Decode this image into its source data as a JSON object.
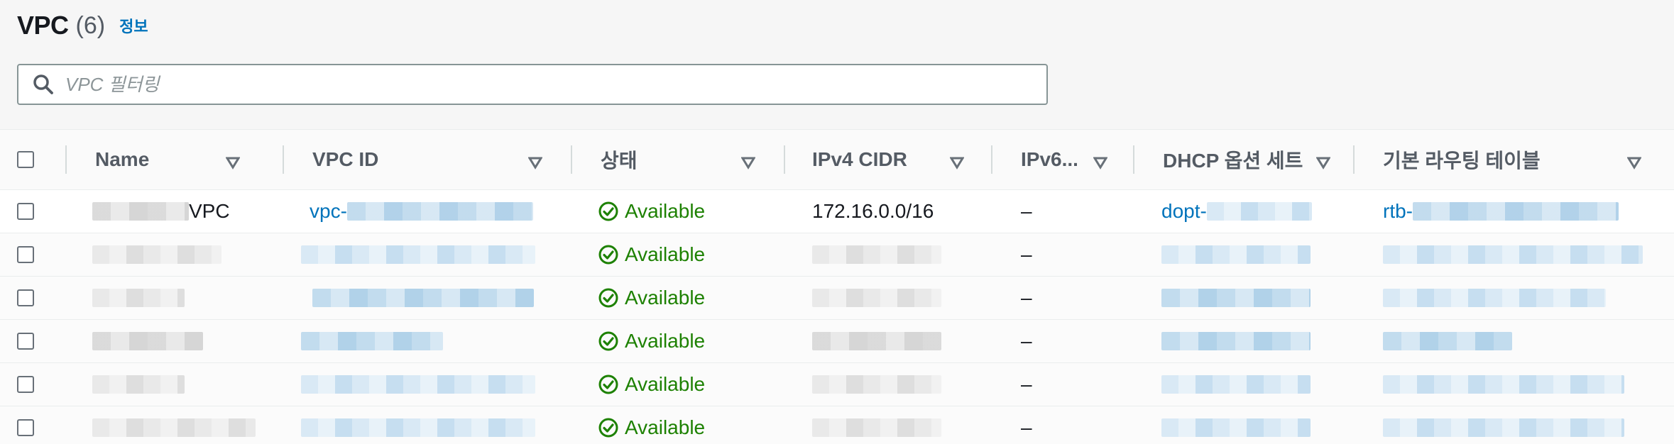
{
  "header": {
    "title": "VPC",
    "count": "(6)",
    "info_link": "정보"
  },
  "search": {
    "placeholder": "VPC 필터링",
    "value": ""
  },
  "table": {
    "columns": [
      {
        "label": "Name"
      },
      {
        "label": "VPC ID"
      },
      {
        "label": "상태"
      },
      {
        "label": "IPv4 CIDR"
      },
      {
        "label": "IPv6..."
      },
      {
        "label": "DHCP 옵션 세트"
      },
      {
        "label": "기본 라우팅 테이블"
      }
    ],
    "rows": [
      {
        "name_suffix": "VPC",
        "vpc_id_prefix": "vpc-",
        "status": "Available",
        "ipv4_cidr": "172.16.0.0/16",
        "ipv6": "–",
        "dhcp_prefix": "dopt-",
        "rtb_prefix": "rtb-"
      },
      {
        "status": "Available",
        "ipv6": "–"
      },
      {
        "status": "Available",
        "ipv6": "–"
      },
      {
        "status": "Available",
        "ipv6": "–"
      },
      {
        "status": "Available",
        "ipv6": "–"
      },
      {
        "status": "Available",
        "ipv6": "–"
      }
    ]
  },
  "colors": {
    "link": "#0073bb",
    "available": "#1d8102",
    "header_text": "#545b64"
  },
  "icons": {
    "search": "search-icon",
    "sort": "sort-caret-icon",
    "status": "check-circle-icon"
  }
}
